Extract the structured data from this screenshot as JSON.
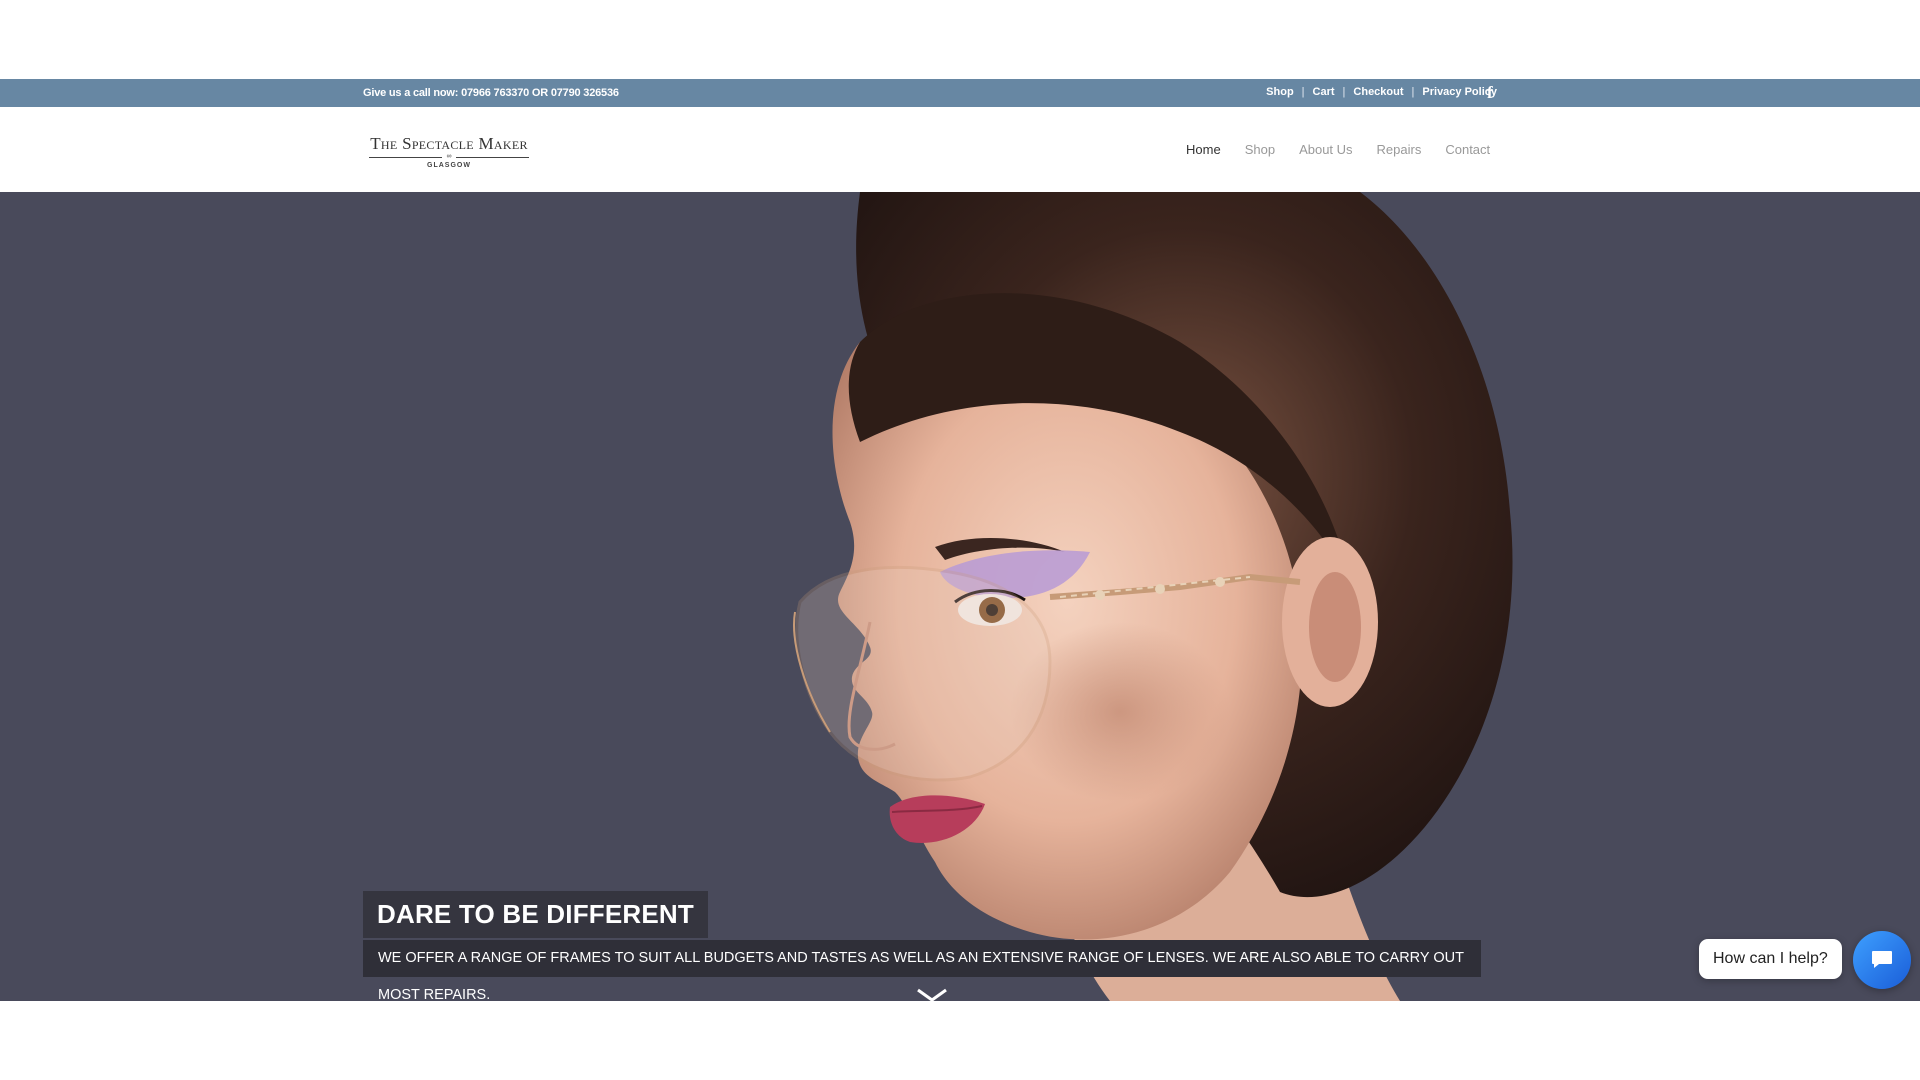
{
  "topbar": {
    "phone_text": "Give us a call now: 07966 763370 OR 07790 326536",
    "links": [
      "Shop",
      "Cart",
      "Checkout",
      "Privacy Policy"
    ],
    "separator": "|",
    "social_icon": "facebook-icon",
    "social_glyph": "f"
  },
  "logo": {
    "name": "The Spectacle Maker",
    "glass_glyph": "∞",
    "city": "GLASGOW"
  },
  "nav": {
    "items": [
      "Home",
      "Shop",
      "About Us",
      "Repairs",
      "Contact"
    ],
    "active": "Home"
  },
  "hero": {
    "headline": "DARE TO BE DIFFERENT",
    "subline": "WE OFFER A RANGE OF FRAMES TO SUIT ALL BUDGETS AND TASTES AS WELL AS AN EXTENSIVE RANGE OF LENSES. WE ARE ALSO ABLE TO CARRY OUT MOST REPAIRS.",
    "scroll_icon": "chevron-down-icon"
  },
  "chat": {
    "prompt": "How can I help?",
    "icon": "chat-bubble-icon"
  },
  "colors": {
    "topbar": "#6787a3",
    "hero_background": "#494a5b",
    "caption_background": "#35353f",
    "chat_accent": "#1a5dd8"
  }
}
